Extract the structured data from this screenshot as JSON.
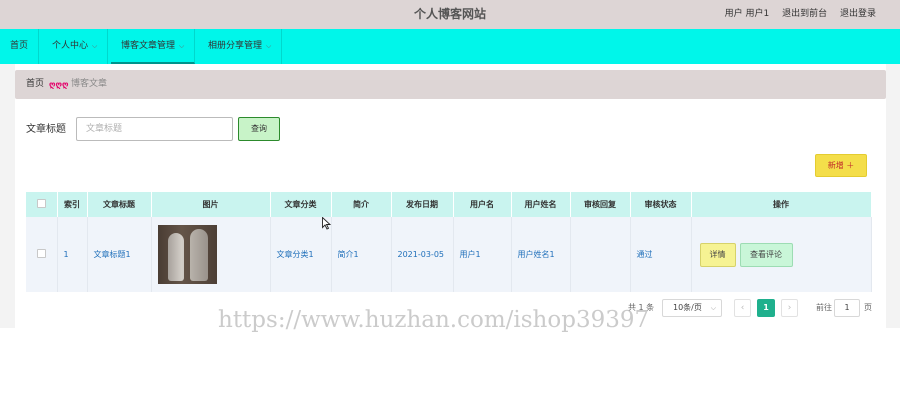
{
  "header": {
    "site_title": "个人博客网站",
    "user_label": "用户 用户1",
    "back_to_front": "退出到前台",
    "logout": "退出登录"
  },
  "nav": {
    "items": [
      {
        "label": "首页"
      },
      {
        "label": "个人中心"
      },
      {
        "label": "博客文章管理"
      },
      {
        "label": "相册分享管理"
      }
    ]
  },
  "breadcrumb": {
    "home": "首页",
    "separator": "ღღღ",
    "current": "博客文章"
  },
  "search": {
    "label": "文章标题",
    "placeholder": "文章标题",
    "button": "查询"
  },
  "toolbar": {
    "add_label": "新增 ＋"
  },
  "table": {
    "columns": [
      "",
      "索引",
      "文章标题",
      "图片",
      "文章分类",
      "简介",
      "发布日期",
      "用户名",
      "用户姓名",
      "审核回复",
      "审核状态",
      "操作"
    ],
    "rows": [
      {
        "index": "1",
        "title": "文章标题1",
        "category": "文章分类1",
        "summary": "简介1",
        "date": "2021-03-05",
        "username": "用户1",
        "realname": "用户姓名1",
        "reply": "",
        "status": "通过",
        "detail_button": "详情",
        "comment_button": "查看评论"
      }
    ]
  },
  "pagination": {
    "total": "共 1 条",
    "page_size": "10条/页",
    "current_page": "1",
    "goto_label": "前往",
    "goto_value": "1",
    "page_unit": "页"
  },
  "watermark": "https://www.huzhan.com/ishop39397",
  "colors": {
    "header_bg": "#ddd5d5",
    "nav_bg": "#00f6ea",
    "table_header_bg": "#c9f4ef",
    "link": "#1f6fba",
    "add_button": "#f4de4a",
    "pager_active": "#1fb08d"
  }
}
